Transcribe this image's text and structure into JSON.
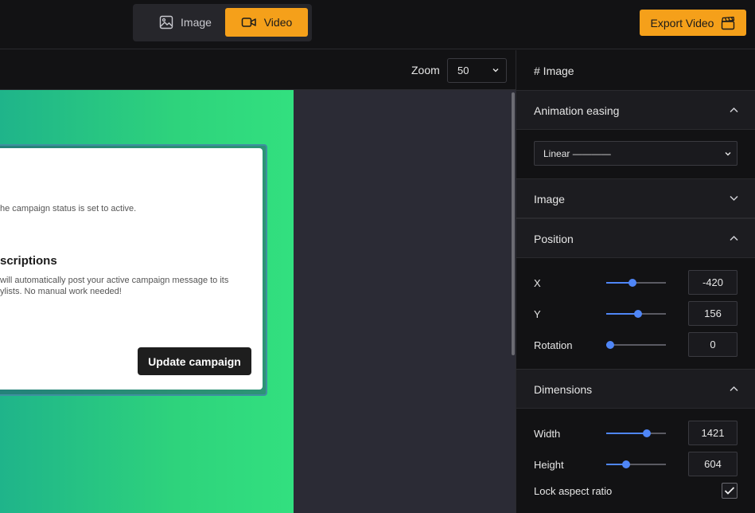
{
  "topbar": {
    "mode_image_label": "Image",
    "mode_video_label": "Video",
    "export_label": "Export Video"
  },
  "canvas": {
    "zoom_label": "Zoom",
    "zoom_value": "50",
    "card": {
      "text_line1": "he campaign status is set to active.",
      "heading": "scriptions",
      "text_line2": "will automatically post your active campaign message to its",
      "text_line3": "ylists. No manual work needed!",
      "button_label": "Update campaign"
    }
  },
  "panel": {
    "title": "# Image",
    "sections": {
      "animation_easing": "Animation easing",
      "image": "Image",
      "position": "Position",
      "dimensions": "Dimensions"
    },
    "easing_value": "Linear ————",
    "position": {
      "x": {
        "label": "X",
        "value": "-420",
        "slider_fraction": 0.44
      },
      "y": {
        "label": "Y",
        "value": "156",
        "slider_fraction": 0.53
      },
      "rotation": {
        "label": "Rotation",
        "value": "0",
        "slider_fraction": 0.07
      }
    },
    "dimensions": {
      "width": {
        "label": "Width",
        "value": "1421",
        "slider_fraction": 0.68
      },
      "height": {
        "label": "Height",
        "value": "604",
        "slider_fraction": 0.33
      },
      "lock_label": "Lock aspect ratio",
      "lock_checked": true
    }
  },
  "colors": {
    "accent": "#f5a01a",
    "slider": "#4f86f7",
    "gradient_start": "#1fb48a",
    "gradient_end": "#32e07f"
  }
}
